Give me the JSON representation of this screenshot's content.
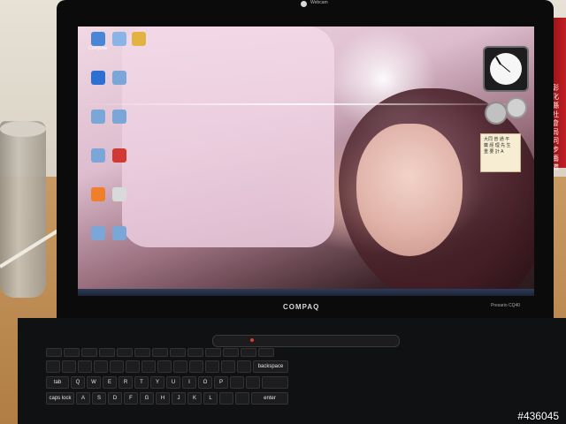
{
  "laptop": {
    "webcam_label": "Webcam",
    "brand": "COMPAQ",
    "model": "Presario CQ40"
  },
  "desktop": {
    "sticky_note": [
      "大同 普 通 平",
      "藥 經 理 先 生",
      "重 要 計 A"
    ],
    "icons": [
      {
        "label": "Computer",
        "icon": "computer-icon"
      },
      {
        "label": "",
        "icon": "recycle-bin-icon"
      },
      {
        "label": "",
        "icon": "folder-icon"
      },
      {
        "label": "",
        "icon": "ie-icon"
      },
      {
        "label": "",
        "icon": "app-icon"
      },
      {
        "label": "",
        "icon": "app-icon"
      },
      {
        "label": "",
        "icon": "app-icon"
      },
      {
        "label": "",
        "icon": "app-icon"
      },
      {
        "label": "",
        "icon": "avira-icon"
      },
      {
        "label": "",
        "icon": "firefox-icon"
      },
      {
        "label": "",
        "icon": "document-icon"
      },
      {
        "label": "",
        "icon": "app-icon"
      },
      {
        "label": "",
        "icon": "app-icon"
      }
    ]
  },
  "keyboard": {
    "labels": {
      "tab": "tab",
      "caps_lock": "caps lock",
      "backspace": "backspace",
      "enter": "enter",
      "q": "Q",
      "w": "W",
      "e": "E",
      "r": "R",
      "t": "T",
      "y": "Y",
      "u": "U",
      "i": "I",
      "o": "O",
      "p": "P",
      "a": "A",
      "s": "S",
      "d": "D",
      "f": "F",
      "g": "G",
      "h": "H",
      "j": "J",
      "k": "K",
      "l": "L"
    }
  },
  "side_object": {
    "text": "彰化縣社會局同步籌備"
  },
  "watermark": "#436045"
}
